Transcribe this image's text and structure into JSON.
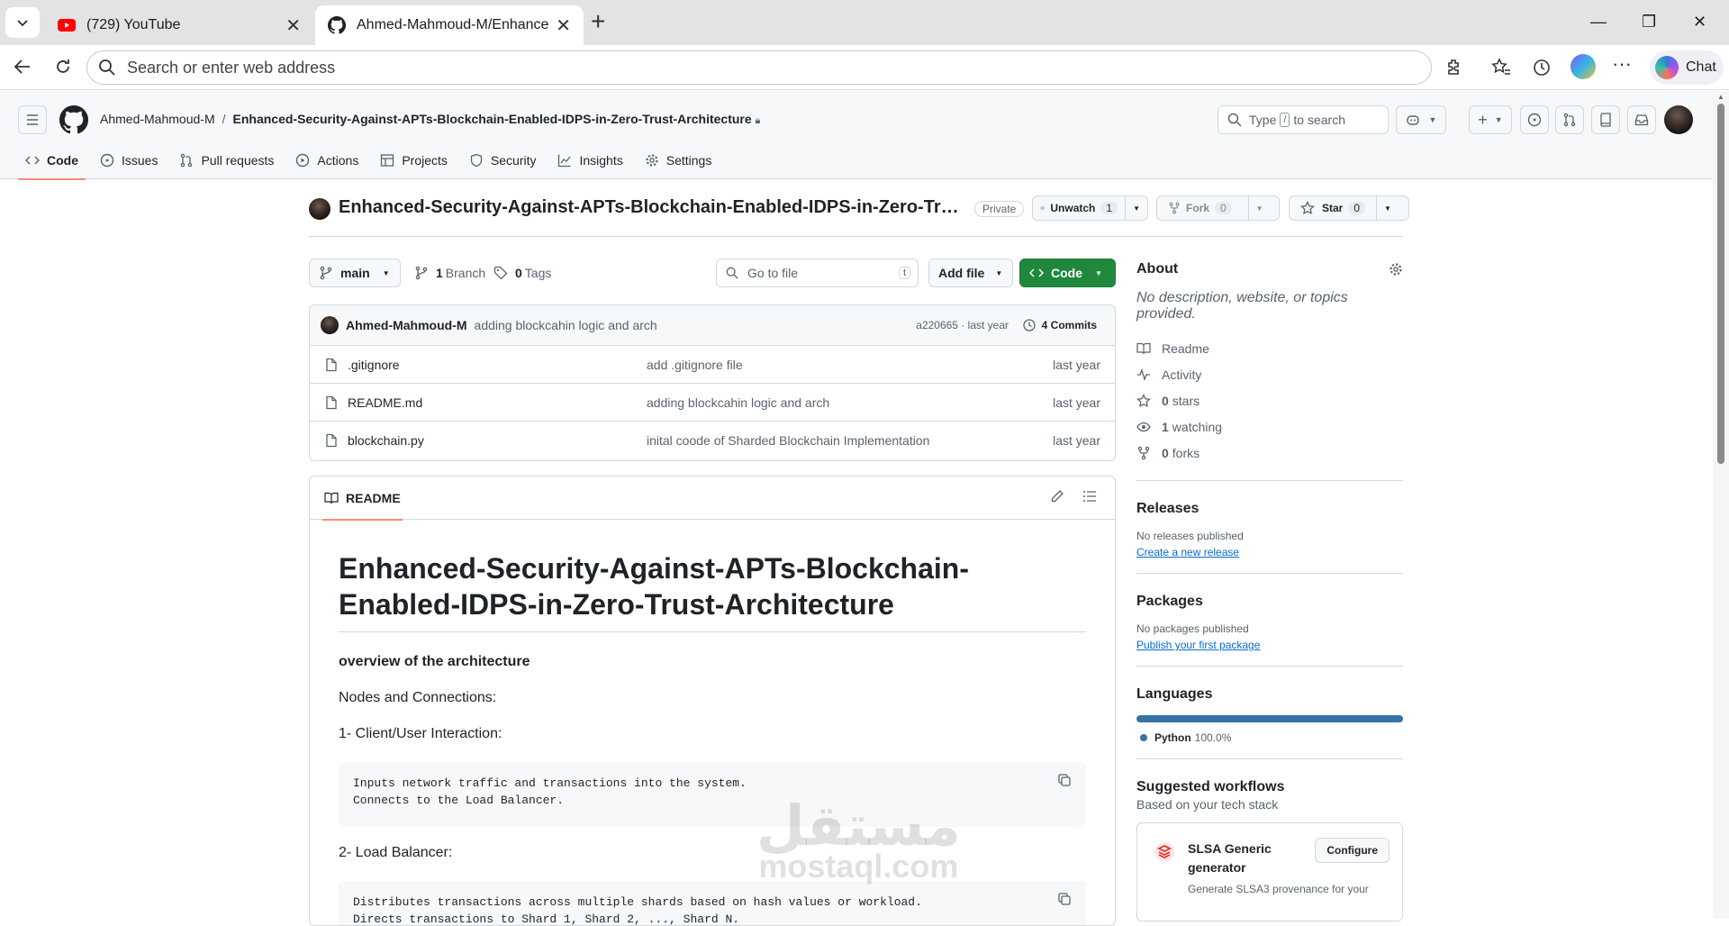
{
  "browser": {
    "tabs": [
      {
        "title": "(729) YouTube",
        "icon": "youtube-icon"
      },
      {
        "title": "Ahmed-Mahmoud-M/Enhanced-S",
        "icon": "github-icon"
      }
    ],
    "address_placeholder": "Search or enter web address",
    "chat_label": "Chat"
  },
  "github": {
    "owner": "Ahmed-Mahmoud-M",
    "repo_full": "Enhanced-Security-Against-APTs-Blockchain-Enabled-IDPS-in-Zero-Trust-Architecture",
    "search": {
      "prefix": "Type",
      "key": "/",
      "suffix": "to search"
    },
    "repo_nav": [
      "Code",
      "Issues",
      "Pull requests",
      "Actions",
      "Projects",
      "Security",
      "Insights",
      "Settings"
    ]
  },
  "repo": {
    "title": "Enhanced-Security-Against-APTs-Blockchain-Enabled-IDPS-in-Zero-Trust-Architecture",
    "visibility": "Private",
    "unwatch": {
      "label": "Unwatch",
      "count": "1"
    },
    "fork": {
      "label": "Fork",
      "count": "0"
    },
    "star": {
      "label": "Star",
      "count": "0"
    }
  },
  "toolbar": {
    "branch": "main",
    "branches_count": "1",
    "branches_label": "Branch",
    "tags_count": "0",
    "tags_label": "Tags",
    "goto_placeholder": "Go to file",
    "goto_key": "t",
    "add_file": "Add file",
    "code": "Code"
  },
  "latest_commit": {
    "author": "Ahmed-Mahmoud-M",
    "message": "adding blockcahin logic and arch",
    "hash": "a220665 · last year",
    "commits": "4 Commits"
  },
  "files": [
    {
      "name": ".gitignore",
      "commit": "add .gitignore file",
      "time": "last year"
    },
    {
      "name": "README.md",
      "commit": "adding blockcahin logic and arch",
      "time": "last year"
    },
    {
      "name": "blockchain.py",
      "commit": "inital coode of Sharded Blockchain Implementation",
      "time": "last year"
    }
  ],
  "readme": {
    "tab": "README",
    "title": "Enhanced-Security-Against-APTs-Blockchain-Enabled-IDPS-in-Zero-Trust-Architecture",
    "overview": "overview of the architecture",
    "nodes": "Nodes and Connections:",
    "h1": "1- Client/User Interaction:",
    "code1": "Inputs network traffic and transactions into the system.\nConnects to the Load Balancer.",
    "h2": "2- Load Balancer:",
    "code2": "Distributes transactions across multiple shards based on hash values or workload.\nDirects transactions to Shard 1, Shard 2, ..., Shard N."
  },
  "about": {
    "title": "About",
    "desc": "No description, website, or topics provided.",
    "readme": "Readme",
    "activity": "Activity",
    "stars": "0",
    "stars_label": "stars",
    "watching": "1",
    "watching_label": "watching",
    "forks": "0",
    "forks_label": "forks"
  },
  "releases": {
    "title": "Releases",
    "none": "No releases published",
    "link": "Create a new release"
  },
  "packages": {
    "title": "Packages",
    "none": "No packages published",
    "link": "Publish your first package"
  },
  "languages": {
    "title": "Languages",
    "name": "Python",
    "pct": "100.0%",
    "color": "#3572a5",
    "share": 1.0
  },
  "workflows": {
    "title": "Suggested workflows",
    "sub": "Based on your tech stack",
    "name": "SLSA Generic generator",
    "btn": "Configure",
    "desc": "Generate SLSA3 provenance for your"
  },
  "watermark": {
    "arabic": "مستقل",
    "latin": "mostaql.com"
  }
}
